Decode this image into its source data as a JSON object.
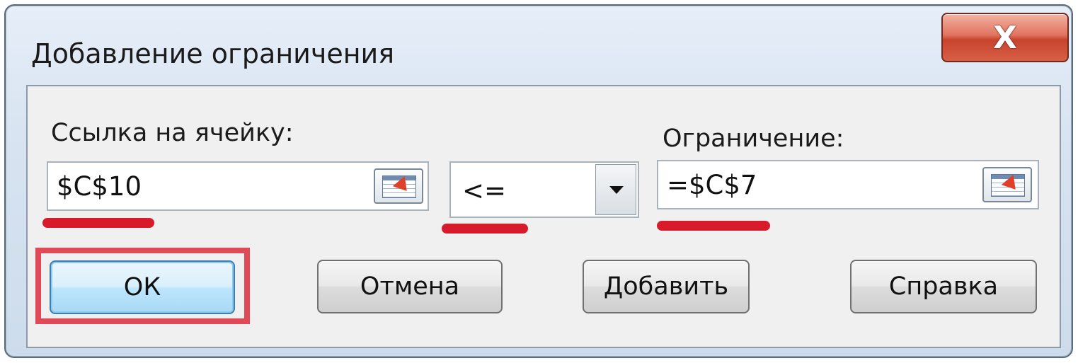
{
  "window": {
    "title": "Добавление ограничения",
    "close_glyph": "X"
  },
  "cell_ref": {
    "label": "Ссылка на ячейку:",
    "value": "$C$10",
    "ref_icon": "collapse-dialog-icon"
  },
  "operator": {
    "selected": "<="
  },
  "constraint": {
    "label": "Ограничение:",
    "value": "=$C$7",
    "ref_icon": "collapse-dialog-icon"
  },
  "buttons": {
    "ok": "ОК",
    "cancel": "Отмена",
    "add": "Добавить",
    "help": "Справка"
  },
  "colors": {
    "annotation_red": "#d81b2a",
    "ok_highlight": "#e04a57",
    "close_button": "#c8432d"
  }
}
